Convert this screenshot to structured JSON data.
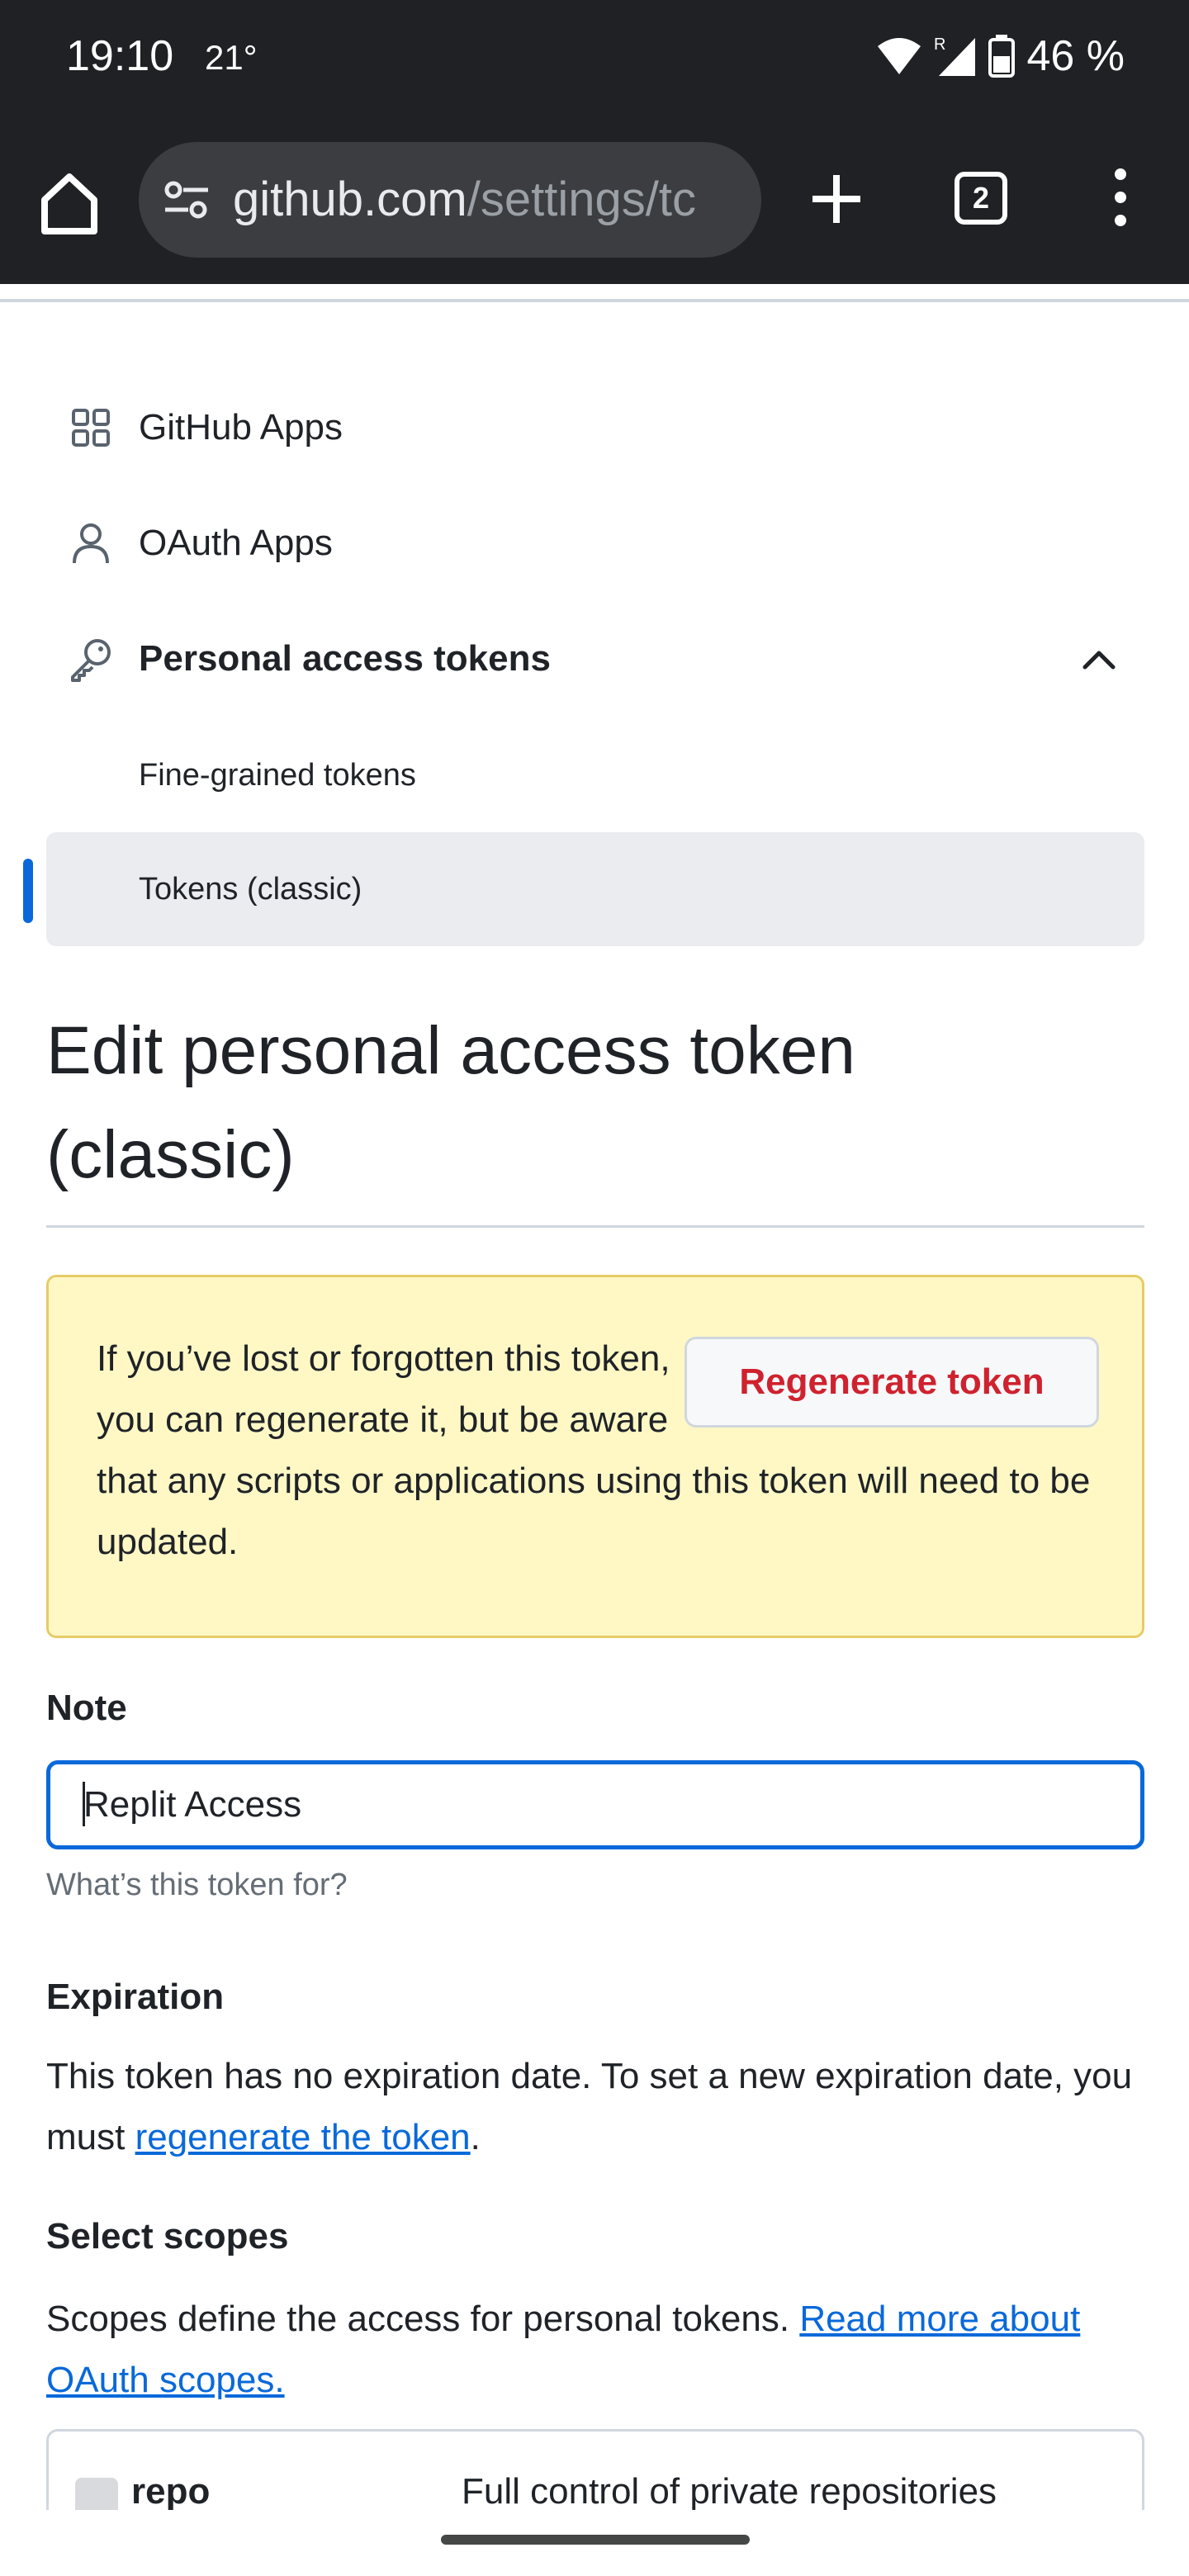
{
  "status_bar": {
    "time": "19:10",
    "temperature": "21°",
    "battery": "46 %"
  },
  "browser": {
    "url_domain": "github.com",
    "url_path": "/settings/tc",
    "tab_count": "2"
  },
  "sidebar": {
    "items": [
      {
        "label": "GitHub Apps",
        "icon": "apps-grid-icon"
      },
      {
        "label": "OAuth Apps",
        "icon": "person-icon"
      },
      {
        "label": "Personal access tokens",
        "icon": "key-icon"
      }
    ],
    "sub_items": [
      {
        "label": "Fine-grained tokens"
      },
      {
        "label": "Tokens (classic)"
      }
    ]
  },
  "page": {
    "title": "Edit personal access token (classic)"
  },
  "warning": {
    "text": "If you’ve lost or forgotten this token, you can regenerate it, but be aware that any scripts or applications using this token will need to be updated.",
    "button_label": "Regenerate token"
  },
  "note": {
    "label": "Note",
    "value": "Replit Access",
    "hint": "What’s this token for?"
  },
  "expiration": {
    "label": "Expiration",
    "text_before": "This token has no expiration date. To set a new expiration date, you must ",
    "link": "regenerate the token",
    "text_after": "."
  },
  "scopes": {
    "label": "Select scopes",
    "text_before": "Scopes define the access for personal tokens. ",
    "link": "Read more about OAuth scopes.",
    "rows": [
      {
        "name": "repo",
        "description": "Full control of private repositories"
      }
    ]
  },
  "colors": {
    "accent": "#0969da",
    "danger": "#cf222e",
    "warning_bg": "#fff8c5",
    "chrome_bg": "#202124"
  }
}
